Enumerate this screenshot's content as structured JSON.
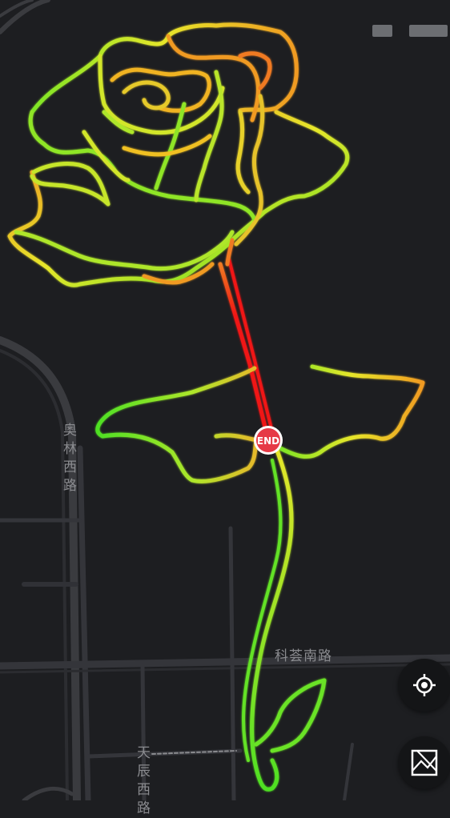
{
  "map": {
    "road_labels": {
      "aolin_west_road": "奥林西路",
      "kehui_south_road": "科荟南路",
      "tianchen_west_road": "天辰西路"
    },
    "end_marker": {
      "label": "END",
      "color": "#e63946"
    },
    "route_colors": {
      "fast": "#4ee024",
      "medium": "#e6e62a",
      "slow": "#f07a22",
      "slowest": "#f01414"
    }
  },
  "controls": {
    "locate_icon": "crosshair-icon",
    "layers_icon": "map-layers-icon"
  }
}
